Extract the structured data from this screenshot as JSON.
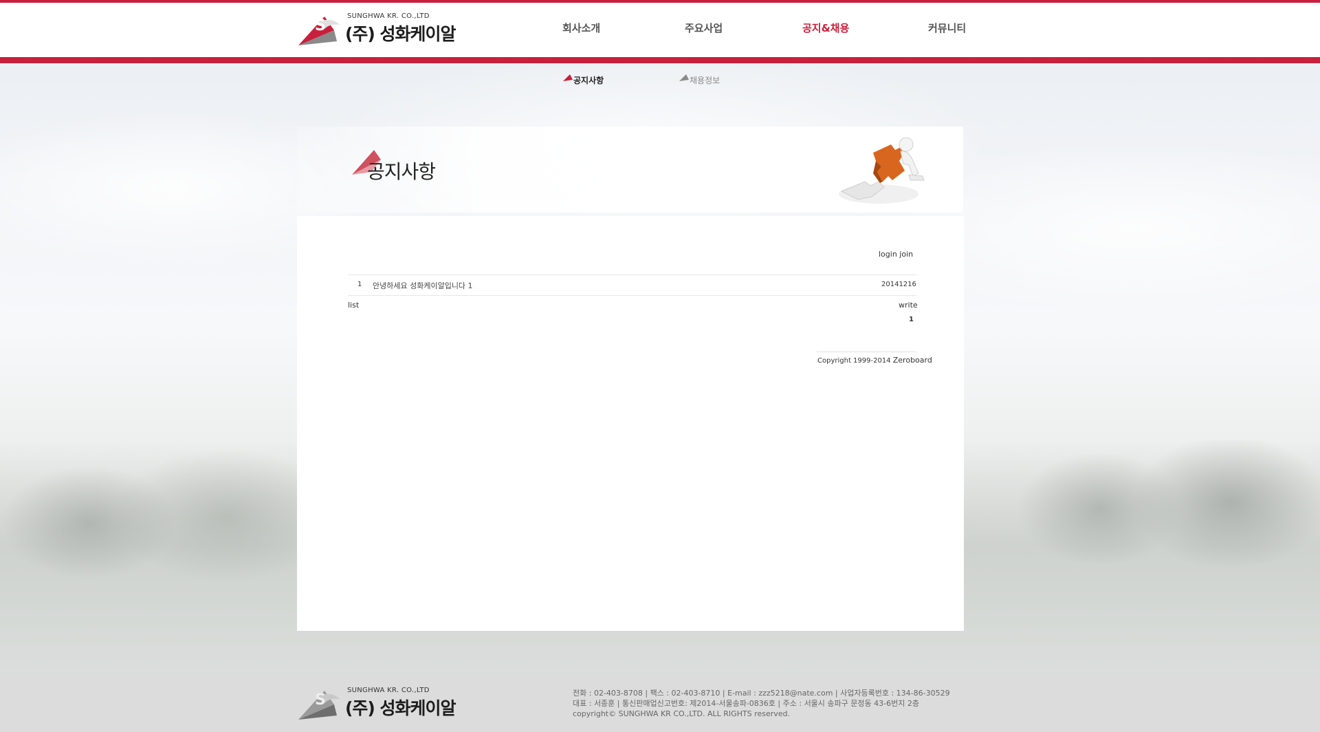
{
  "brand": {
    "eng_name": "SUNGHWA KR. CO.,LTD",
    "kor_name": "(주) 성화케이알",
    "accent": "#c8203c"
  },
  "nav": {
    "items": [
      {
        "label": "회사소개"
      },
      {
        "label": "주요사업"
      },
      {
        "label": "공지&채용"
      },
      {
        "label": "커뮤니티"
      }
    ],
    "active_index": 2
  },
  "subnav": {
    "items": [
      {
        "label": "공지사항"
      },
      {
        "label": "채용정보"
      }
    ]
  },
  "page": {
    "title": "공지사항"
  },
  "board": {
    "login_label": "login",
    "join_label": "join",
    "rows": [
      {
        "num": "1",
        "subject": "안녕하세요 성화케이알입니다 1",
        "date": "20141216"
      }
    ],
    "list_label": "list",
    "write_label": "write",
    "page": "1",
    "copyright_prefix": "Copyright 1999-2014",
    "copyright_brand": "Zeroboard"
  },
  "footer": {
    "line1": "전화 : 02-403-8708  |  팩스 : 02-403-8710   |   E-mail : zzz5218@nate.com  | 사업자등록번호 : 134-86-30529",
    "line2": "대표 : 서종훈 |  통신판매업신고번호: 제2014-서울송파-0836호  |   주소 : 서울시 송파구 문정동 43-6번지 2층",
    "line3": "copyright© SUNGHWA KR CO.,LTD. ALL RIGHTS reserved."
  }
}
